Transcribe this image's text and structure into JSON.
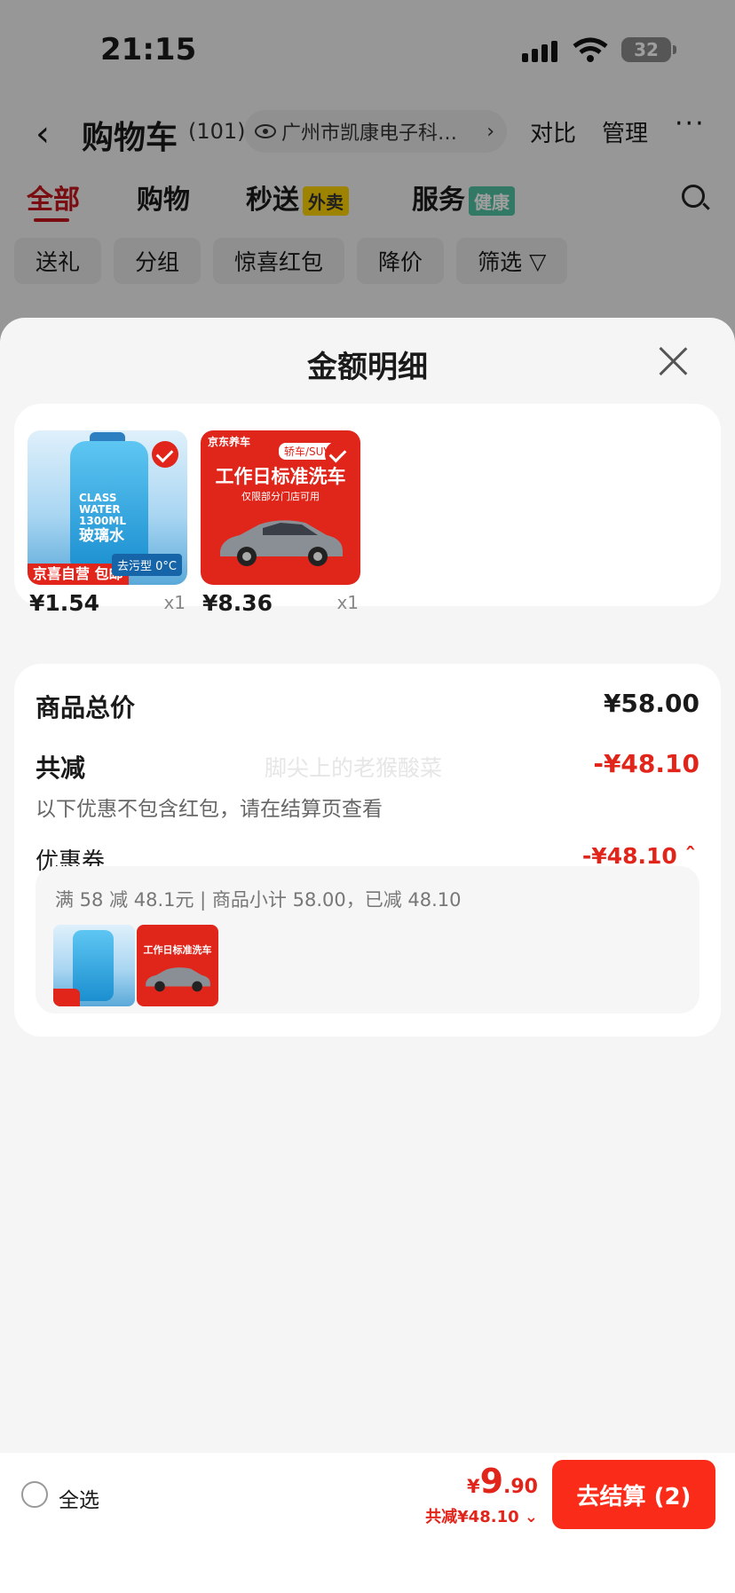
{
  "status": {
    "time": "21:15",
    "battery": "32"
  },
  "nav": {
    "title": "购物车",
    "count": "(101)",
    "address": "广州市凯康电子科…",
    "compare": "对比",
    "manage": "管理",
    "more": "···"
  },
  "tabs": [
    {
      "label": "全部"
    },
    {
      "label": "购物"
    },
    {
      "label": "秒送",
      "badge": "外卖"
    },
    {
      "label": "服务",
      "badge": "健康"
    }
  ],
  "chips": [
    "送礼",
    "分组",
    "惊喜红包",
    "降价",
    "筛选"
  ],
  "sheet": {
    "title": "金额明细",
    "products": [
      {
        "price": "¥1.54",
        "qty": "x1",
        "label_line1": "CLASS WATER",
        "label_line2": "1300ML",
        "label_line3": "玻璃水",
        "tag_left": "京喜自营 包邮",
        "tag_right": "去污型 0°C"
      },
      {
        "price": "¥8.36",
        "qty": "x1",
        "brand": "京东养车",
        "sub": "轿车/SUV",
        "title": "工作日标准洗车",
        "note": "仅限部分门店可用"
      }
    ],
    "total_label": "商品总价",
    "total_value": "¥58.00",
    "reduce_label": "共减",
    "reduce_value": "-¥48.10",
    "reduce_note": "以下优惠不包含红包，请在结算页查看",
    "coupon_label": "优惠券",
    "coupon_value": "-¥48.10",
    "coupon_desc": "满 58 减 48.1元 | 商品小计 58.00，已减 48.10",
    "watermark": "脚尖上的老猴酸菜"
  },
  "bottom": {
    "select_all": "全选",
    "currency": "¥",
    "total_int": "9",
    "total_dec": ".90",
    "discount": "共减¥48.10",
    "checkout": "去结算 (2)"
  },
  "colors": {
    "accent": "#e1251b",
    "checkout_bg": "#fa2c19"
  }
}
